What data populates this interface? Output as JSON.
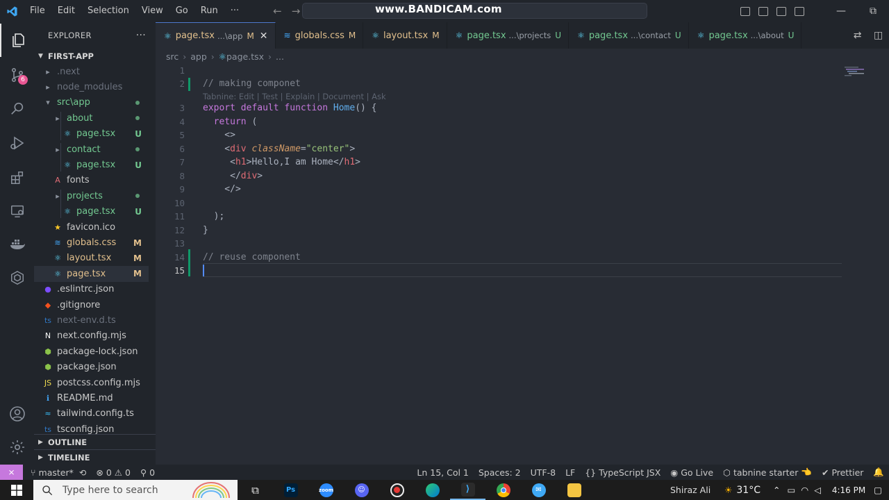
{
  "titlebar": {
    "menu": [
      "File",
      "Edit",
      "Selection",
      "View",
      "Go",
      "Run",
      "···"
    ],
    "watermark": "www.BANDICAM.com",
    "window_minimize": "—",
    "window_restore": "⧉"
  },
  "activity_bar": {
    "items": [
      {
        "name": "explorer-icon",
        "active": true
      },
      {
        "name": "source-control-icon",
        "badge": "6"
      },
      {
        "name": "search-icon"
      },
      {
        "name": "run-debug-icon"
      },
      {
        "name": "extensions-icon"
      },
      {
        "name": "remote-explorer-icon"
      },
      {
        "name": "docker-icon"
      },
      {
        "name": "tabnine-icon"
      }
    ],
    "bottom": [
      {
        "name": "account-icon"
      },
      {
        "name": "settings-gear-icon"
      }
    ]
  },
  "sidebar": {
    "title": "EXPLORER",
    "more": "···",
    "project": "FIRST-APP",
    "outline": "OUTLINE",
    "timeline": "TIMELINE",
    "tree": [
      {
        "label": ".next",
        "depth": 0,
        "icon": "folder-icon",
        "color": "dim"
      },
      {
        "label": "node_modules",
        "depth": 0,
        "icon": "folder-icon",
        "color": "dim"
      },
      {
        "label": "src\\app",
        "depth": 0,
        "icon": "folder-open-icon",
        "color": "unt",
        "dot": true
      },
      {
        "label": "about",
        "depth": 1,
        "icon": "folder-icon",
        "color": "unt",
        "dot": true
      },
      {
        "label": "page.tsx",
        "depth": 2,
        "icon": "react-icon",
        "color": "unt",
        "status": "U"
      },
      {
        "label": "contact",
        "depth": 1,
        "icon": "folder-icon",
        "color": "unt",
        "dot": true
      },
      {
        "label": "page.tsx",
        "depth": 2,
        "icon": "react-icon",
        "color": "unt",
        "status": "U"
      },
      {
        "label": "fonts",
        "depth": 1,
        "icon": "font-icon",
        "color": "lbl"
      },
      {
        "label": "projects",
        "depth": 1,
        "icon": "folder-icon",
        "color": "unt",
        "dot": true
      },
      {
        "label": "page.tsx",
        "depth": 2,
        "icon": "react-icon",
        "color": "unt",
        "status": "U"
      },
      {
        "label": "favicon.ico",
        "depth": 1,
        "icon": "star-icon",
        "color": "lbl"
      },
      {
        "label": "globals.css",
        "depth": 1,
        "icon": "css-icon",
        "color": "mod",
        "status": "M"
      },
      {
        "label": "layout.tsx",
        "depth": 1,
        "icon": "react-icon",
        "color": "mod",
        "status": "M"
      },
      {
        "label": "page.tsx",
        "depth": 1,
        "icon": "react-icon",
        "color": "mod",
        "status": "M",
        "selected": true
      },
      {
        "label": ".eslintrc.json",
        "depth": 0,
        "icon": "eslint-icon",
        "color": "lbl"
      },
      {
        "label": ".gitignore",
        "depth": 0,
        "icon": "git-icon",
        "color": "lbl"
      },
      {
        "label": "next-env.d.ts",
        "depth": 0,
        "icon": "typescript-icon",
        "color": "dim"
      },
      {
        "label": "next.config.mjs",
        "depth": 0,
        "icon": "next-icon",
        "color": "lbl"
      },
      {
        "label": "package-lock.json",
        "depth": 0,
        "icon": "npm-icon",
        "color": "lbl"
      },
      {
        "label": "package.json",
        "depth": 0,
        "icon": "npm-icon",
        "color": "lbl"
      },
      {
        "label": "postcss.config.mjs",
        "depth": 0,
        "icon": "js-icon",
        "color": "lbl"
      },
      {
        "label": "README.md",
        "depth": 0,
        "icon": "info-icon",
        "color": "lbl"
      },
      {
        "label": "tailwind.config.ts",
        "depth": 0,
        "icon": "tailwind-icon",
        "color": "lbl"
      },
      {
        "label": "tsconfig.json",
        "depth": 0,
        "icon": "tsconfig-icon",
        "color": "lbl"
      }
    ]
  },
  "tabs": [
    {
      "label": "page.tsx",
      "desc": "...\\app",
      "status": "M",
      "active": true,
      "close": "✕"
    },
    {
      "label": "globals.css",
      "desc": "",
      "status": "M",
      "icon": "css-icon"
    },
    {
      "label": "layout.tsx",
      "desc": "",
      "status": "M"
    },
    {
      "label": "page.tsx",
      "desc": "...\\projects",
      "status": "U"
    },
    {
      "label": "page.tsx",
      "desc": "...\\contact",
      "status": "U"
    },
    {
      "label": "page.tsx",
      "desc": "...\\about",
      "status": "U"
    }
  ],
  "breadcrumb": [
    "src",
    "app",
    "page.tsx",
    "..."
  ],
  "editor": {
    "codelens": "Tabnine: Edit | Test | Explain | Document | Ask",
    "lines": [
      {
        "n": "1",
        "tokens": []
      },
      {
        "n": "2",
        "tokens": [
          {
            "t": "// making componet",
            "c": "com"
          }
        ]
      },
      {
        "n": "3",
        "tokens": [
          {
            "t": "export",
            "c": "kw"
          },
          {
            "t": " ",
            "c": "txt"
          },
          {
            "t": "default",
            "c": "kw"
          },
          {
            "t": " ",
            "c": "txt"
          },
          {
            "t": "function",
            "c": "kw"
          },
          {
            "t": " ",
            "c": "txt"
          },
          {
            "t": "Home",
            "c": "fn"
          },
          {
            "t": "() {",
            "c": "pun"
          }
        ]
      },
      {
        "n": "4",
        "tokens": [
          {
            "t": "  ",
            "c": "txt"
          },
          {
            "t": "return",
            "c": "kw"
          },
          {
            "t": " (",
            "c": "pun"
          }
        ]
      },
      {
        "n": "5",
        "tokens": [
          {
            "t": "    <>",
            "c": "pun"
          }
        ]
      },
      {
        "n": "6",
        "tokens": [
          {
            "t": "    <",
            "c": "pun"
          },
          {
            "t": "div",
            "c": "tag"
          },
          {
            "t": " ",
            "c": "txt"
          },
          {
            "t": "className",
            "c": "attr"
          },
          {
            "t": "=",
            "c": "pun"
          },
          {
            "t": "\"center\"",
            "c": "str"
          },
          {
            "t": ">",
            "c": "pun"
          }
        ]
      },
      {
        "n": "7",
        "tokens": [
          {
            "t": "     <",
            "c": "pun"
          },
          {
            "t": "h1",
            "c": "tag"
          },
          {
            "t": ">Hello,I am Home</",
            "c": "txt"
          },
          {
            "t": "h1",
            "c": "tag"
          },
          {
            "t": ">",
            "c": "pun"
          }
        ]
      },
      {
        "n": "8",
        "tokens": [
          {
            "t": "     </",
            "c": "pun"
          },
          {
            "t": "div",
            "c": "tag"
          },
          {
            "t": ">",
            "c": "pun"
          }
        ]
      },
      {
        "n": "9",
        "tokens": [
          {
            "t": "    </>",
            "c": "pun"
          }
        ]
      },
      {
        "n": "10",
        "tokens": []
      },
      {
        "n": "11",
        "tokens": [
          {
            "t": "  );",
            "c": "pun"
          }
        ]
      },
      {
        "n": "12",
        "tokens": [
          {
            "t": "}",
            "c": "pun"
          }
        ]
      },
      {
        "n": "13",
        "tokens": []
      },
      {
        "n": "14",
        "tokens": [
          {
            "t": "// reuse component",
            "c": "com"
          }
        ]
      },
      {
        "n": "15",
        "tokens": [],
        "current": true
      }
    ]
  },
  "statusbar": {
    "branch": "master*",
    "errors": "0",
    "warnings": "0",
    "ports": "0",
    "position": "Ln 15, Col 1",
    "spaces": "Spaces: 2",
    "encoding": "UTF-8",
    "eol": "LF",
    "language": "TypeScript JSX",
    "golive": "Go Live",
    "tabnine": "tabnine starter",
    "prettier": "Prettier"
  },
  "taskbar": {
    "search_placeholder": "Type here to search",
    "user": "Shiraz Ali",
    "temperature": "31°C",
    "time": "4:16 PM"
  },
  "colors": {
    "accent": "#4d78cc",
    "modified": "#e2c08d",
    "untracked": "#73c991",
    "remote": "#c678dd"
  }
}
